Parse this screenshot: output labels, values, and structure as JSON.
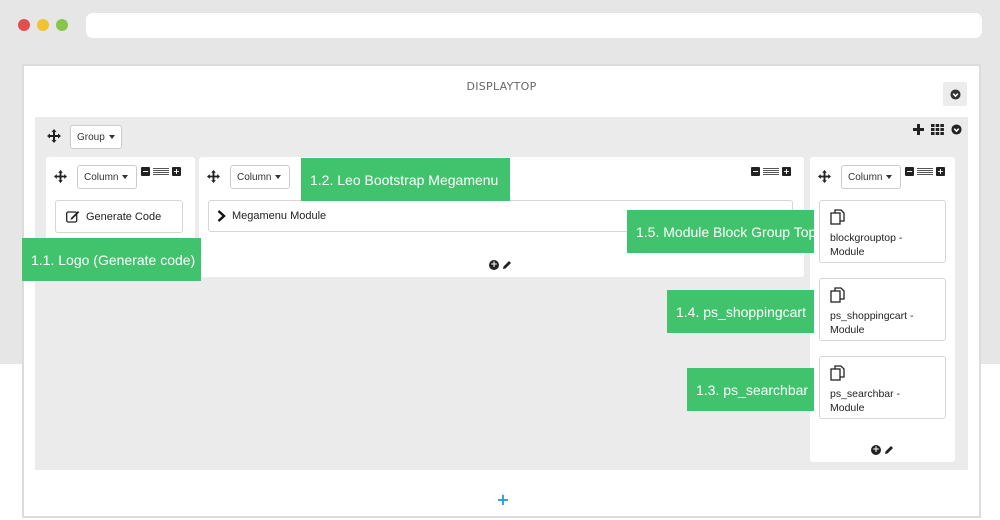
{
  "window": {
    "traffic_lights": [
      "#e0504f",
      "#f0c330",
      "#89c54b"
    ]
  },
  "panel": {
    "title": "DISPLAYTOP"
  },
  "group": {
    "dropdown_label": "Group"
  },
  "columns": [
    {
      "dropdown_label": "Column",
      "content": "Generate Code"
    },
    {
      "dropdown_label": "Column",
      "content": "Megamenu Module"
    },
    {
      "dropdown_label": "Column",
      "modules": [
        {
          "name": "blockgrouptop",
          "suffix": "-",
          "type": "Module"
        },
        {
          "name": "ps_shoppingcart",
          "suffix": "-",
          "type": "Module"
        },
        {
          "name": "ps_searchbar",
          "suffix": "-",
          "type": "Module"
        }
      ]
    }
  ],
  "callouts": {
    "logo": "1.1. Logo (Generate code)",
    "megamenu": "1.2. Leo Bootstrap Megamenu",
    "searchbar": "1.3. ps_searchbar",
    "shoppingcart": "1.4. ps_shoppingcart",
    "blockgroup": "1.5. Module Block Group Top"
  },
  "colors": {
    "callout": "#41c36d",
    "accent_plus": "#2a9fd6"
  }
}
